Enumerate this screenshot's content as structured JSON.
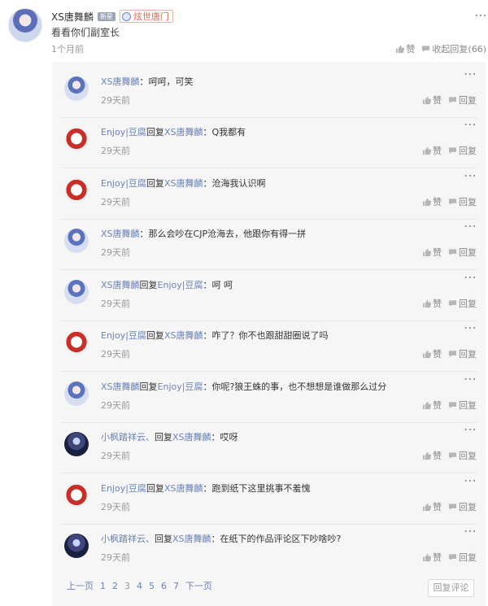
{
  "main_post": {
    "username": "XS唐舞麟",
    "badge": "新星",
    "fan_tag": "炫世唐门",
    "content": "看看你们副室长",
    "time": "1个月前",
    "like_label": "赞",
    "collapse_label": "收起回复(66)"
  },
  "replies": [
    {
      "avatar": "xs",
      "user": "XS唐舞麟",
      "reply_to": "",
      "text": "：呵呵，可笑",
      "time": "29天前"
    },
    {
      "avatar": "enjoy",
      "user": "Enjoy|豆腐",
      "reply_to": "XS唐舞麟",
      "text": "：Q我都有",
      "time": "29天前"
    },
    {
      "avatar": "enjoy",
      "user": "Enjoy|豆腐",
      "reply_to": "XS唐舞麟",
      "text": "：沧海我认识啊",
      "time": "29天前"
    },
    {
      "avatar": "xs",
      "user": "XS唐舞麟",
      "reply_to": "",
      "text": "：那么会吵在CJP沧海去，他跟你有得一拼",
      "time": "29天前"
    },
    {
      "avatar": "xs",
      "user": "XS唐舞麟",
      "reply_to": "Enjoy|豆腐",
      "text": "：呵 呵",
      "time": "29天前"
    },
    {
      "avatar": "enjoy",
      "user": "Enjoy|豆腐",
      "reply_to": "XS唐舞麟",
      "text": "：咋了？你不也跟甜甜圈说了吗",
      "time": "29天前"
    },
    {
      "avatar": "xs",
      "user": "XS唐舞麟",
      "reply_to": "Enjoy|豆腐",
      "text": "：你呢?狼王蛛的事，也不想想是谁做那么过分",
      "time": "29天前"
    },
    {
      "avatar": "xiaofeng",
      "user": "小枫踏祥云、",
      "reply_to": "XS唐舞麟",
      "text": "：哎呀",
      "time": "29天前"
    },
    {
      "avatar": "enjoy",
      "user": "Enjoy|豆腐",
      "reply_to": "XS唐舞麟",
      "text": "：跑到纸下这里挑事不羞愧",
      "time": "29天前"
    },
    {
      "avatar": "xiaofeng",
      "user": "小枫踏祥云、",
      "reply_to": "XS唐舞麟",
      "text": "：在纸下的作品评论区下吵啥吵?",
      "time": "29天前"
    }
  ],
  "reply_labels": {
    "reply_word": "回复",
    "like": "赞",
    "reply": "回复"
  },
  "pagination": {
    "prev": "上一页",
    "pages": [
      "1",
      "2",
      "3",
      "4",
      "5",
      "6",
      "7"
    ],
    "current": "4",
    "next": "下一页"
  },
  "reply_comment_button": "回复评论",
  "colors": {
    "link": "#6b82b7",
    "text": "#333333",
    "muted": "#999999",
    "tag": "#d66b56",
    "reply_bg": "#f6f6f6"
  }
}
